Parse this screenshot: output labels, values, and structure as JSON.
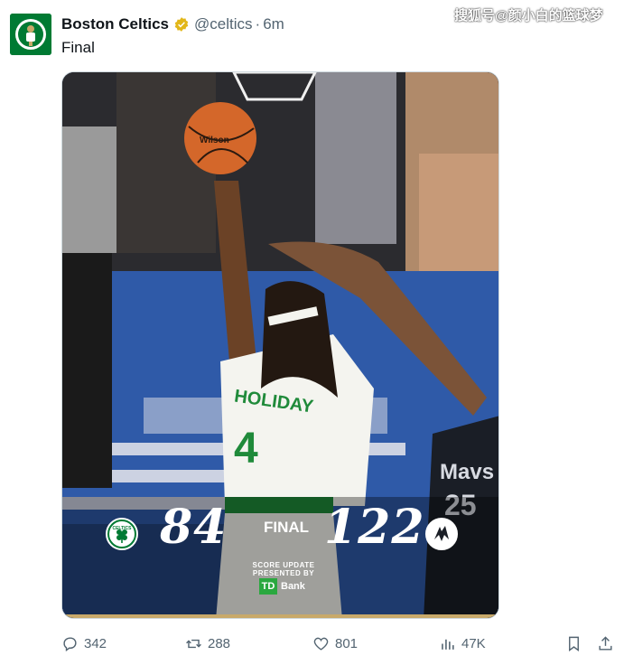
{
  "watermark": "搜狐号@颜小白的篮球梦",
  "tweet": {
    "author_name": "Boston Celtics",
    "handle": "@celtics",
    "separator": "·",
    "time": "6m",
    "text": "Final",
    "verified_icon": "verified-badge-icon"
  },
  "media": {
    "jersey_name": "HOLIDAY",
    "jersey_number": "4",
    "opponent_jersey_text": "Mavs",
    "opponent_jersey_number": "25",
    "ball_text": "Wilson",
    "score_home": "84",
    "score_label": "FINAL",
    "score_away": "122",
    "home_logo_text": "CELTICS",
    "presented_by": "SCORE UPDATE PRESENTED BY",
    "sponsor_logo": "TD",
    "sponsor_name": "Bank",
    "colors": {
      "celtics_green": "#007a33",
      "gold": "#c8a96a",
      "td_green": "#2aa83f"
    }
  },
  "actions": {
    "replies": "342",
    "reposts": "288",
    "likes": "801",
    "views": "47K"
  }
}
